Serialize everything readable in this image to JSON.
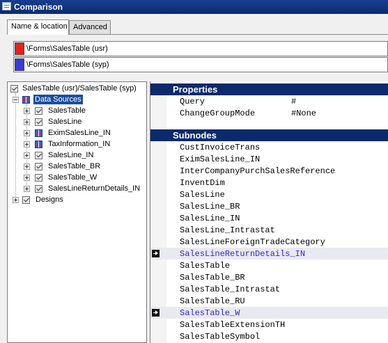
{
  "window": {
    "title": "Comparison"
  },
  "tabs": [
    {
      "label": "Name & location"
    },
    {
      "label": "Advanced"
    }
  ],
  "locations": [
    {
      "path": "\\Forms\\SalesTable (usr)",
      "color": "#e8201a"
    },
    {
      "path": "\\Forms\\SalesTable (syp)",
      "color": "#3a3ad8"
    }
  ],
  "tree": {
    "root": "SalesTable (usr)/SalesTable (syp)",
    "data_sources": "Data Sources",
    "children": [
      {
        "label": "SalesTable"
      },
      {
        "label": "SalesLine"
      },
      {
        "label": "EximSalesLine_IN"
      },
      {
        "label": "TaxInformation_IN"
      },
      {
        "label": "SalesLine_IN"
      },
      {
        "label": "SalesTable_BR"
      },
      {
        "label": "SalesTable_W"
      },
      {
        "label": "SalesLineReturnDetails_IN"
      }
    ],
    "designs": "Designs"
  },
  "properties": {
    "header": "Properties",
    "rows": [
      {
        "name": "Query",
        "value": "#"
      },
      {
        "name": "ChangeGroupMode",
        "value": "#None"
      }
    ]
  },
  "subnodes": {
    "header": "Subnodes",
    "items": [
      {
        "name": "CustInvoiceTrans"
      },
      {
        "name": "EximSalesLine_IN"
      },
      {
        "name": "InterCompanyPurchSalesReference"
      },
      {
        "name": "InventDim"
      },
      {
        "name": "SalesLine"
      },
      {
        "name": "SalesLine_BR"
      },
      {
        "name": "SalesLine_IN"
      },
      {
        "name": "SalesLine_Intrastat"
      },
      {
        "name": "SalesLineForeignTradeCategory"
      },
      {
        "name": "SalesLineReturnDetails_IN"
      },
      {
        "name": "SalesTable"
      },
      {
        "name": "SalesTable_BR"
      },
      {
        "name": "SalesTable_Intrastat"
      },
      {
        "name": "SalesTable_RU"
      },
      {
        "name": "SalesTable_W"
      },
      {
        "name": "SalesTableExtensionTH"
      },
      {
        "name": "SalesTableSymbol"
      }
    ]
  }
}
